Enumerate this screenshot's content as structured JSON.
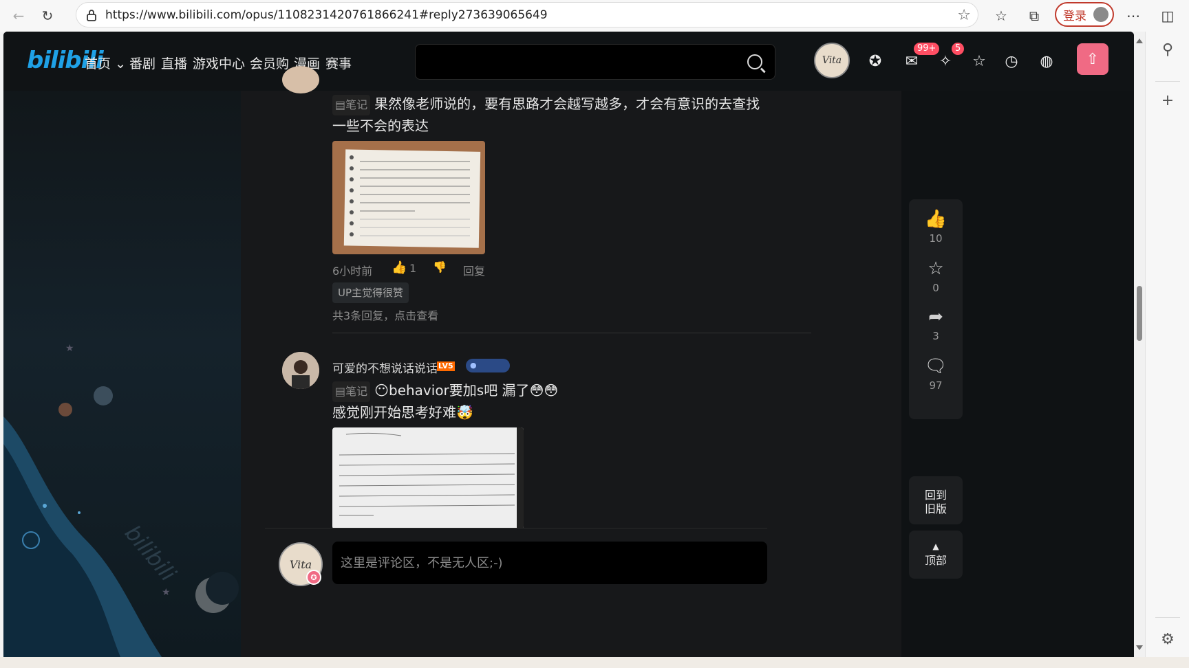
{
  "browser": {
    "url": "https://www.bilibili.com/opus/1108231420761866241#reply273639065649",
    "login_label": "登录",
    "icons": [
      "back-icon",
      "reload-icon",
      "lock-icon",
      "favorite-star-icon",
      "favorites-icon",
      "collections-icon",
      "more-icon",
      "sidebar-toggle-icon",
      "search-icon",
      "add-icon",
      "settings-icon"
    ]
  },
  "header": {
    "logo": "bilibili",
    "nav": [
      "首页",
      "番剧",
      "直播",
      "游戏中心",
      "会员购",
      "漫画",
      "赛事"
    ],
    "search_placeholder": "",
    "avatar_text": "Vita",
    "message_badge": "99+",
    "dynamic_badge": "5",
    "accent": "#f06a84"
  },
  "comments": [
    {
      "tag": "笔记",
      "text": "果然像老师说的，要有思路才会越写越多，才会有意识的去查找一些不会的表达",
      "time": "6小时前",
      "likes": "1",
      "reply": "回复",
      "up_tag": "UP主觉得很赞",
      "replies_summary": "共3条回复，点击查看"
    },
    {
      "username": "可爱的不想说话说话",
      "level": "LV5",
      "tag": "笔记",
      "line1": "behavior要加s吧 漏了",
      "line2": "感觉刚开始思考好难"
    }
  ],
  "side_panel": {
    "like_count": "10",
    "favorite_count": "0",
    "share_count": "3",
    "comment_count": "97",
    "old_version_label": "回到\n旧版",
    "top_label": "顶部"
  },
  "comment_box": {
    "placeholder": "这里是评论区，不是无人区;-)",
    "avatar_text": "Vita"
  }
}
